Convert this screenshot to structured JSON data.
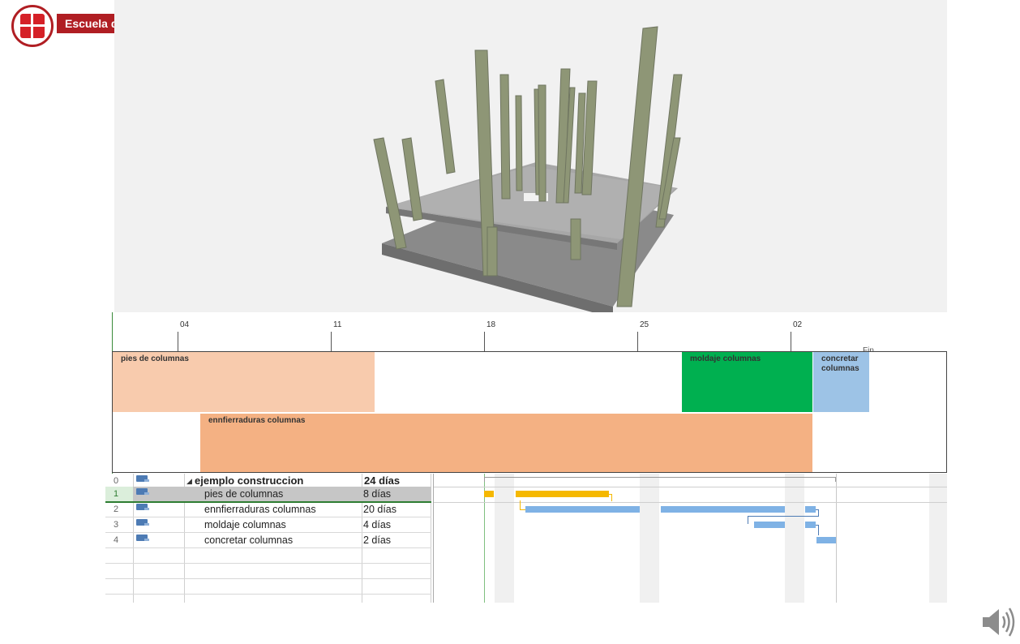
{
  "logo": {
    "org_name": "Escuela de Formación Técnica Chile"
  },
  "timeline": {
    "ticks": [
      "04",
      "11",
      "18",
      "25",
      "02"
    ],
    "end_label": "Fin",
    "bars": [
      {
        "label": "pies de columnas",
        "color": "#f8cbad"
      },
      {
        "label": "ennfierraduras columnas",
        "color": "#f4b183"
      },
      {
        "label": "moldaje columnas",
        "color": "#00b050"
      },
      {
        "label": "concretar columnas",
        "color": "#9dc3e6"
      }
    ]
  },
  "gantt": {
    "rows": [
      {
        "id": "0",
        "name": "ejemplo construccion",
        "duration": "24 días",
        "summary": true
      },
      {
        "id": "1",
        "name": "pies de columnas",
        "duration": "8 días",
        "selected": true
      },
      {
        "id": "2",
        "name": "ennfierraduras columnas",
        "duration": "20 días"
      },
      {
        "id": "3",
        "name": "moldaje columnas",
        "duration": "4 días"
      },
      {
        "id": "4",
        "name": "concretar columnas",
        "duration": "2 días"
      }
    ],
    "colors": {
      "critical": "#f5b800",
      "normal": "#7fb2e5",
      "selected_row": "#c6c6c6",
      "selected_id_bg": "#dbeedb"
    }
  },
  "icons": {
    "speaker": "speaker-icon",
    "building": "building-3d-image"
  }
}
